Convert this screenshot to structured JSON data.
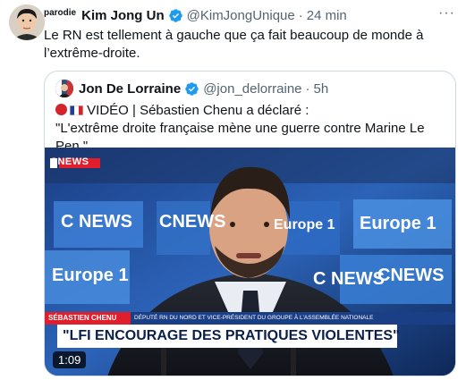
{
  "tweet": {
    "parody_label": "parodie",
    "author_name": "Kim Jong Un",
    "handle": "@KimJongUnique",
    "separator": "·",
    "time": "24 min",
    "more_label": "···",
    "text": "Le RN est tellement à gauche que ça fait beaucoup de monde à l’extrême-droite."
  },
  "quote": {
    "author_name": "Jon De Lorraine",
    "handle": "@jon_delorraine",
    "separator": "·",
    "time": "5h",
    "line1": "VIDÉO | Sébastien Chenu a déclaré :",
    "line2": "\"L'extrême droite française mène une guerre contre Marine Le Pen.\""
  },
  "video": {
    "channel_logo": "CNEWS",
    "screen_words": [
      "C NEWS",
      "Europe 1",
      "CNEWS",
      "Europe 1",
      "C NEWS",
      "Europe 1",
      "CNEWS"
    ],
    "chyron_name": "SÉBASTIEN CHENU",
    "chyron_role": "DÉPUTÉ RN DU NORD ET VICE-PRÉSIDENT DU GROUPE À L'ASSEMBLÉE NATIONALE",
    "chyron_quote": "\"LFI ENCOURAGE DES PRATIQUES VIOLENTES\"",
    "duration": "1:09"
  },
  "colors": {
    "verified": "#1d9bf0",
    "secondary_text": "#536471",
    "border": "#cfd9de"
  }
}
